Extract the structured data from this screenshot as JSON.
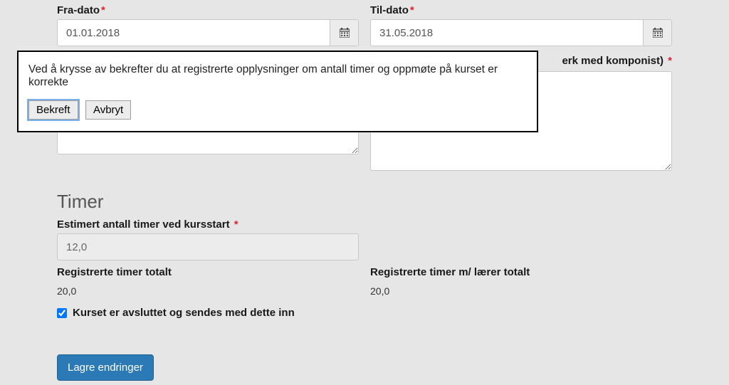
{
  "dates": {
    "from_label": "Fra-dato",
    "from_value": "01.01.2018",
    "to_label": "Til-dato",
    "to_value": "31.05.2018"
  },
  "right_partial_label": "erk med komponist)",
  "timer": {
    "section_title": "Timer",
    "est_label": "Estimert antall timer ved kursstart",
    "est_value": "12,0",
    "reg_total_label": "Registrerte timer totalt",
    "reg_total_value": "20,0",
    "reg_teacher_label": "Registrerte timer m/ lærer totalt",
    "reg_teacher_value": "20,0",
    "checkbox_label": "Kurset er avsluttet og sendes med dette inn"
  },
  "buttons": {
    "primary": "Lagre endringer"
  },
  "popup": {
    "text": "Ved å krysse av bekrefter du at registrerte opplysninger om antall timer og oppmøte på kurset er korrekte",
    "confirm": "Bekreft",
    "cancel": "Avbryt"
  }
}
